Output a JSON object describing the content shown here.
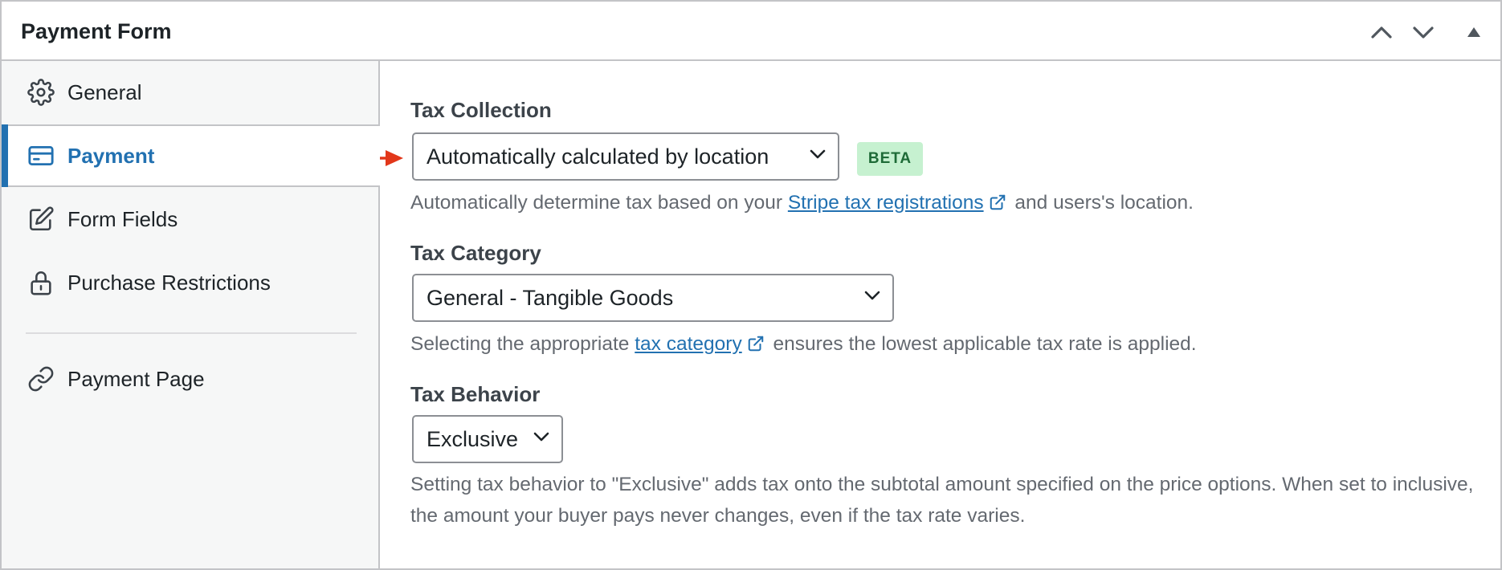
{
  "panel": {
    "title": "Payment Form",
    "controls": [
      "chevron-up-icon",
      "chevron-down-icon",
      "triangle-up-icon"
    ]
  },
  "sidebar": {
    "items": [
      {
        "label": "General",
        "icon": "gear-icon"
      },
      {
        "label": "Payment",
        "icon": "credit-card-icon",
        "active": true
      },
      {
        "label": "Form Fields",
        "icon": "edit-icon"
      },
      {
        "label": "Purchase Restrictions",
        "icon": "lock-icon"
      },
      {
        "label": "Payment Page",
        "icon": "link-icon"
      }
    ]
  },
  "tax_collection": {
    "label": "Tax Collection",
    "value": "Automatically calculated by location",
    "badge": "BETA",
    "help_before": "Automatically determine tax based on your",
    "help_link": "Stripe tax registrations",
    "help_after": "and users's location."
  },
  "tax_category": {
    "label": "Tax Category",
    "value": "General - Tangible Goods",
    "help_before": "Selecting the appropriate",
    "help_link": "tax category",
    "help_after": "ensures the lowest applicable tax rate is applied."
  },
  "tax_behavior": {
    "label": "Tax Behavior",
    "value": "Exclusive",
    "help": "Setting tax behavior to \"Exclusive\" adds tax onto the subtotal amount specified on the price options. When set to inclusive, the amount your buyer pays never changes, even if the tax rate varies."
  },
  "colors": {
    "accent": "#2271b1",
    "badge_bg": "#c6f1d0",
    "badge_text": "#1e6b37",
    "arrow": "#e2371a",
    "border": "#c3c4c7"
  }
}
